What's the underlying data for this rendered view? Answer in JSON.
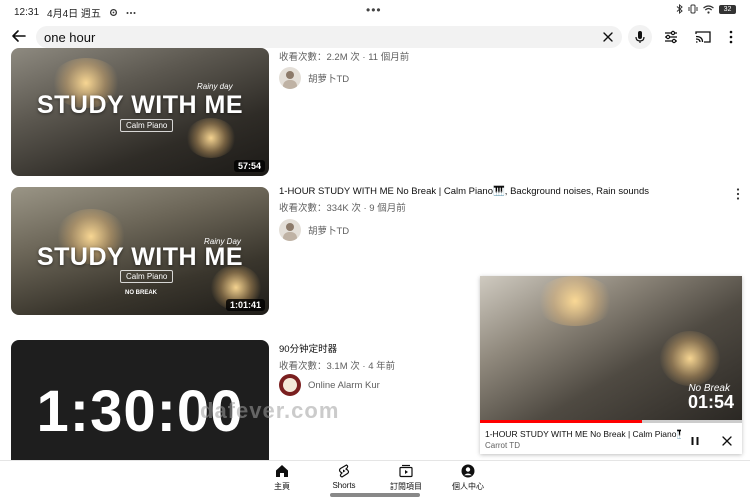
{
  "status_bar": {
    "time": "12:31",
    "date": "4月4日 週五",
    "dots": "•••",
    "battery": "32"
  },
  "search": {
    "query": "one hour"
  },
  "results": [
    {
      "thumb_title": "STUDY WITH ME",
      "thumb_tag": "Rainy day",
      "thumb_sub": "Calm Piano",
      "duration": "57:54",
      "stats": "收看次數：2.2M 次 · 11 個月前",
      "channel": "胡萝卜TD"
    },
    {
      "thumb_title": "STUDY WITH ME",
      "thumb_tag": "Rainy Day",
      "thumb_sub": "Calm Piano",
      "thumb_badge": "NO BREAK",
      "duration": "1:01:41",
      "title": "1-HOUR STUDY WITH ME No Break | Calm Piano🎹, Background noises, Rain sounds",
      "stats": "收看次數：334K 次 · 9 個月前",
      "channel": "胡萝卜TD"
    },
    {
      "thumb_title": "1:30:00",
      "title": "90分钟定时器",
      "stats": "收看次數：3.1M 次 · 4 年前",
      "channel": "Online Alarm Kur"
    }
  ],
  "mini_player": {
    "tag": "No Break",
    "clock": "01:54",
    "title": "1-HOUR STUDY WITH ME No Break | Calm Piano🎹, Ba...",
    "channel": "Carrot TD",
    "progress": 0.62
  },
  "bottom_nav": [
    {
      "label": "主頁",
      "icon": "home-icon"
    },
    {
      "label": "Shorts",
      "icon": "shorts-icon"
    },
    {
      "label": "訂閱項目",
      "icon": "subscriptions-icon"
    },
    {
      "label": "個人中心",
      "icon": "profile-icon"
    }
  ],
  "watermark": "dafever.com",
  "colors": {
    "accent": "#ff0000",
    "text_primary": "#0f0f0f",
    "text_secondary": "#606060",
    "search_bg": "#f2f2f2"
  }
}
